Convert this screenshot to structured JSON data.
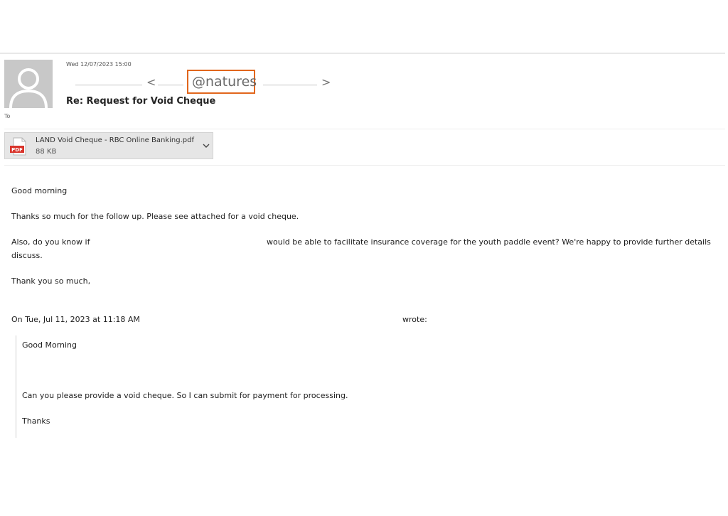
{
  "header": {
    "date": "Wed 12/07/2023 15:00",
    "sender_open": "<",
    "sender_domain": "@natures",
    "sender_close": ">",
    "subject": "Re: Request for Void Cheque",
    "to_label": "To"
  },
  "attachment": {
    "name": "LAND Void Cheque - RBC Online Banking.pdf",
    "size": "88 KB",
    "badge": "PDF",
    "accent": "#d9342b"
  },
  "body": {
    "greeting": "Good morning",
    "line1": "Thanks so much for the follow up. Please see attached for a void cheque.",
    "line2_start": "Also, do you know if",
    "line2_end": "would be able to facilitate insurance coverage for the youth paddle event? We're happy to provide further details",
    "line2_wrap": "discuss.",
    "signoff": "Thank you so much,",
    "quote_header_start": "On Tue, Jul 11, 2023 at 11:18 AM",
    "quote_header_end": "wrote:"
  },
  "quoted": {
    "greeting": "Good Morning",
    "line1": "Can you please provide a void cheque. So I can submit for payment for processing.",
    "signoff": "Thanks"
  },
  "colors": {
    "highlight_border": "#e1661c"
  }
}
